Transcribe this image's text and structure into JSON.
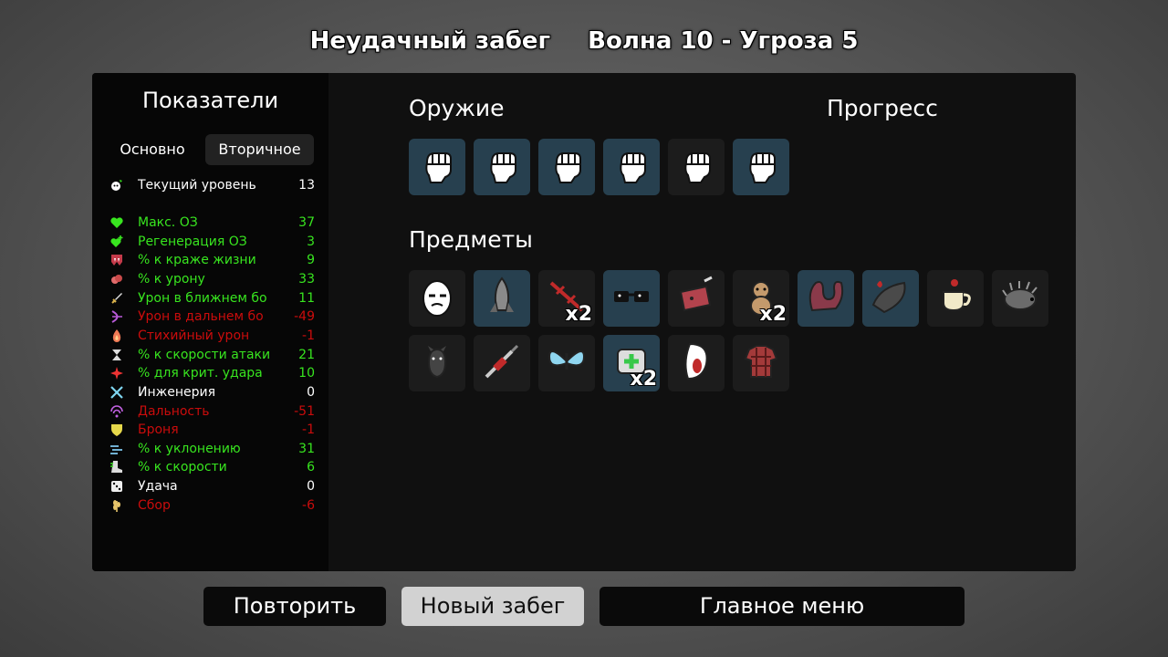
{
  "header": {
    "run_result": "Неудачный забег",
    "wave_info": "Волна 10 - Угроза 5"
  },
  "stats": {
    "title": "Показатели",
    "tabs": [
      {
        "label": "Основно",
        "active": false
      },
      {
        "label": "Вторичное",
        "active": true
      }
    ],
    "current_level": {
      "icon": "level-icon",
      "label": "Текущий уровень",
      "value": "13",
      "color": "#ffffff"
    },
    "rows": [
      {
        "icon": "heart-icon",
        "label": "Макс. ОЗ",
        "value": "37",
        "color": "#38e51f"
      },
      {
        "icon": "heart-plus-icon",
        "label": "Регенерация ОЗ",
        "value": "3",
        "color": "#38e51f"
      },
      {
        "icon": "fangs-icon",
        "label": "% к краже жизни",
        "value": "9",
        "color": "#38e51f"
      },
      {
        "icon": "muscle-icon",
        "label": "% к урону",
        "value": "33",
        "color": "#38e51f"
      },
      {
        "icon": "sword-icon",
        "label": "Урон в ближнем бо",
        "value": "11",
        "color": "#38e51f"
      },
      {
        "icon": "bow-icon",
        "label": "Урон в дальнем бо",
        "value": "-49",
        "color": "#ca0c0c"
      },
      {
        "icon": "flame-icon",
        "label": "Стихийный урон",
        "value": "-1",
        "color": "#ca0c0c"
      },
      {
        "icon": "hourglass-icon",
        "label": "% к скорости атаки",
        "value": "21",
        "color": "#38e51f"
      },
      {
        "icon": "crit-icon",
        "label": "% для крит. удара",
        "value": "10",
        "color": "#38e51f"
      },
      {
        "icon": "wrench-icon",
        "label": "Инженерия",
        "value": "0",
        "color": "#ffffff"
      },
      {
        "icon": "range-icon",
        "label": "Дальность",
        "value": "-51",
        "color": "#ca0c0c"
      },
      {
        "icon": "shield-icon",
        "label": "Броня",
        "value": "-1",
        "color": "#ca0c0c"
      },
      {
        "icon": "wind-icon",
        "label": "% к уклонению",
        "value": "31",
        "color": "#38e51f"
      },
      {
        "icon": "boot-icon",
        "label": "% к скорости",
        "value": "6",
        "color": "#38e51f"
      },
      {
        "icon": "dice-icon",
        "label": "Удача",
        "value": "0",
        "color": "#ffffff"
      },
      {
        "icon": "wheat-icon",
        "label": "Сбор",
        "value": "-6",
        "color": "#ca0c0c"
      }
    ]
  },
  "weapons": {
    "title": "Оружие",
    "items": [
      {
        "icon": "fist-icon",
        "tier": "blue"
      },
      {
        "icon": "fist-icon",
        "tier": "blue"
      },
      {
        "icon": "fist-icon",
        "tier": "blue"
      },
      {
        "icon": "fist-icon",
        "tier": "blue"
      },
      {
        "icon": "fist-icon",
        "tier": "dark"
      },
      {
        "icon": "fist-icon",
        "tier": "blue"
      }
    ]
  },
  "progress": {
    "title": "Прогресс"
  },
  "items": {
    "title": "Предметы",
    "list": [
      {
        "icon": "egg-face-icon",
        "tier": "dark",
        "count": ""
      },
      {
        "icon": "missile-icon",
        "tier": "blue",
        "count": ""
      },
      {
        "icon": "barbed-wire-icon",
        "tier": "dark",
        "count": "x2"
      },
      {
        "icon": "glasses-icon",
        "tier": "blue",
        "count": ""
      },
      {
        "icon": "meat-knife-icon",
        "tier": "dark",
        "count": ""
      },
      {
        "icon": "teddy-bear-icon",
        "tier": "dark",
        "count": "x2"
      },
      {
        "icon": "tentacle-icon",
        "tier": "blue",
        "count": ""
      },
      {
        "icon": "leech-icon",
        "tier": "blue",
        "count": ""
      },
      {
        "icon": "coffee-cup-icon",
        "tier": "dark",
        "count": ""
      },
      {
        "icon": "hedgehog-icon",
        "tier": "dark",
        "count": ""
      },
      {
        "icon": "bat-icon",
        "tier": "dark",
        "count": ""
      },
      {
        "icon": "syringe-icon",
        "tier": "dark",
        "count": ""
      },
      {
        "icon": "butterfly-icon",
        "tier": "dark",
        "count": ""
      },
      {
        "icon": "medkit-icon",
        "tier": "blue",
        "count": "x2"
      },
      {
        "icon": "scared-sausage-icon",
        "tier": "dark",
        "count": ""
      },
      {
        "icon": "plaid-shirt-icon",
        "tier": "dark",
        "count": ""
      }
    ]
  },
  "buttons": {
    "retry": "Повторить",
    "new_run": "Новый забег",
    "main_menu": "Главное меню"
  }
}
